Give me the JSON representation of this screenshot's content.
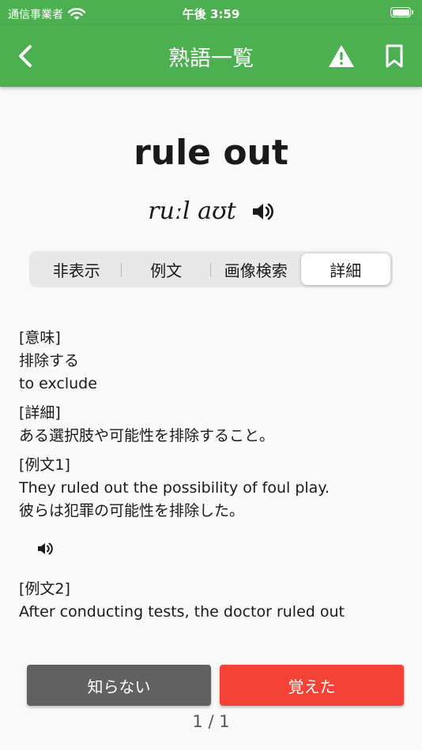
{
  "status": {
    "carrier": "通信事業者",
    "time": "午後 3:59"
  },
  "nav": {
    "title": "熟語一覧"
  },
  "word": {
    "text": "rule out",
    "pronunciation": "ruːl aʊt"
  },
  "tabs": [
    {
      "label": "非表示"
    },
    {
      "label": "例文"
    },
    {
      "label": "画像検索"
    },
    {
      "label": "詳細"
    }
  ],
  "details": {
    "meaning_label": "[意味]",
    "meaning_ja": "排除する",
    "meaning_en": "to exclude",
    "detail_label": "[詳細]",
    "detail_text": "ある選択肢や可能性を排除すること。",
    "ex1_label": "[例文1]",
    "ex1_en": "They ruled out the possibility of foul play.",
    "ex1_ja": "彼らは犯罪の可能性を排除した。",
    "ex2_label": "[例文2]",
    "ex2_en": "After conducting tests, the doctor ruled out"
  },
  "buttons": {
    "unknown": "知らない",
    "known": "覚えた"
  },
  "pager": "1 / 1",
  "colors": {
    "header": "#4caf50",
    "known": "#f44336",
    "unknown": "#616161"
  }
}
